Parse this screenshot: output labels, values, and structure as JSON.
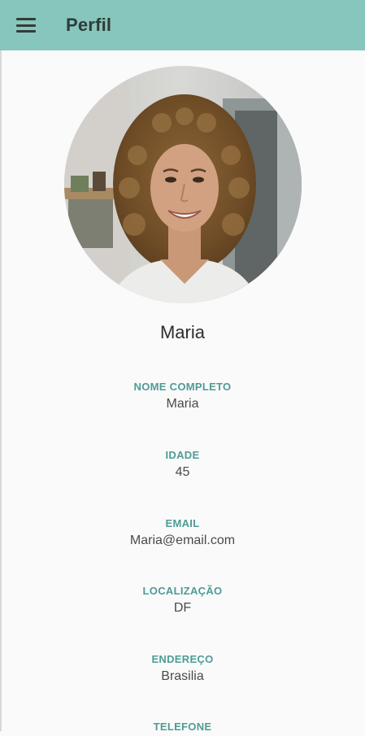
{
  "app_bar": {
    "title": "Perfil",
    "menu_icon": "hamburger-menu-icon",
    "background": "#86c6bc"
  },
  "profile": {
    "name": "Maria",
    "photo": "profile-photo"
  },
  "fields": [
    {
      "label": "NOME COMPLETO",
      "value": "Maria"
    },
    {
      "label": "IDADE",
      "value": "45"
    },
    {
      "label": "EMAIL",
      "value": "Maria@email.com"
    },
    {
      "label": "LOCALIZAÇÃO",
      "value": "DF"
    },
    {
      "label": "ENDEREÇO",
      "value": "Brasilia"
    },
    {
      "label": "TELEFONE",
      "value": ""
    }
  ],
  "colors": {
    "accent": "#4e9c95",
    "background": "#fafafa"
  }
}
